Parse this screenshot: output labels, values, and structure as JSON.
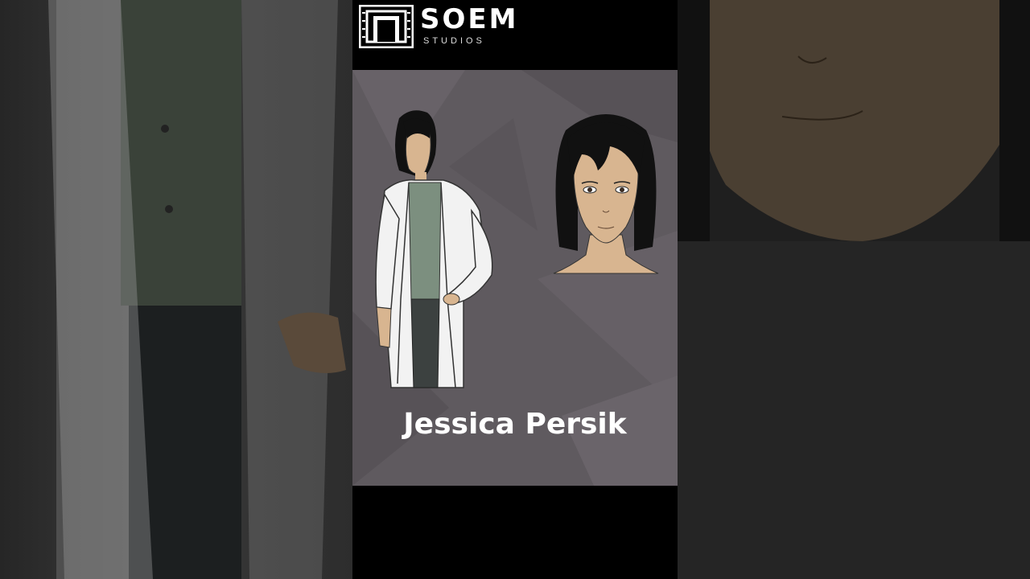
{
  "brand": {
    "name": "SOEM",
    "subtitle": "STUDIOS",
    "logo_icon": "film-frame-icon"
  },
  "character": {
    "name": "Jessica Persik"
  },
  "colors": {
    "panel_background": "#5f5a5f",
    "letterbox": "#000000",
    "name_text": "#ffffff",
    "coat": "#f2f2f2",
    "shirt": "#7c8f7f",
    "hair": "#111111",
    "skin": "#d8b590"
  }
}
